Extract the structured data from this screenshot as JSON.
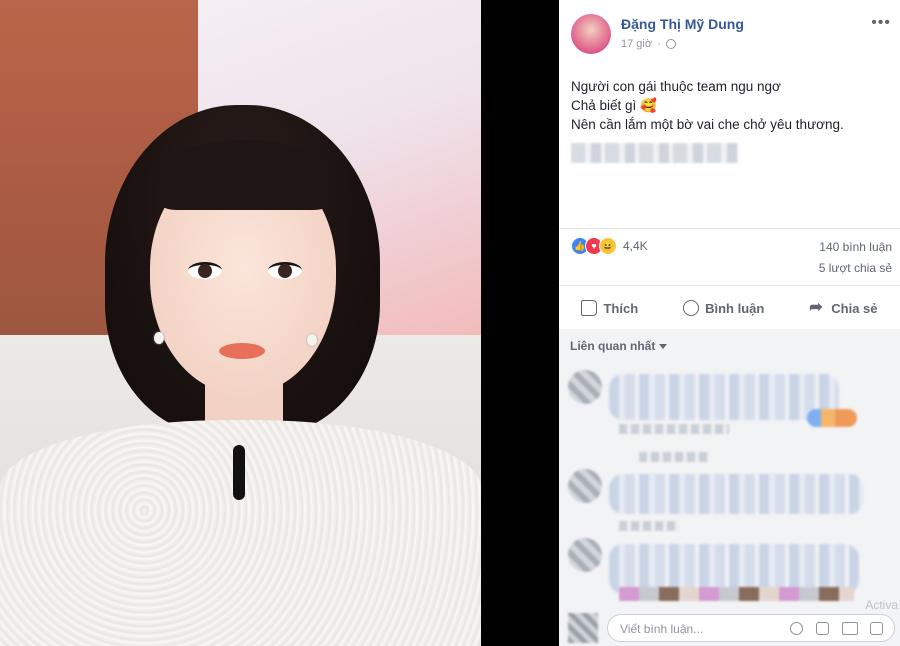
{
  "post": {
    "author": "Đặng Thị Mỹ Dung",
    "time": "17 giờ",
    "text_lines": [
      "Người con gái thuộc team ngu ngơ",
      "Chả biết gì 🥰",
      "Nên cần lắm một bờ vai che chở yêu thương."
    ],
    "reactions_count": "4,4K",
    "comments_count": "140 bình luận",
    "shares_count": "5 lượt chia sẻ"
  },
  "actions": {
    "like": "Thích",
    "comment": "Bình luận",
    "share": "Chia sẻ"
  },
  "comments": {
    "sort_label": "Liên quan nhất"
  },
  "composer": {
    "placeholder": "Viết bình luận..."
  },
  "watermark": "Activa",
  "icons": {
    "globe": "globe-icon",
    "more": "more-icon",
    "like": "thumb-icon",
    "comment": "comment-icon",
    "share": "share-icon",
    "emoji": "emoji-icon",
    "camera": "camera-icon",
    "gif": "gif-icon",
    "sticker": "sticker-icon"
  },
  "colors": {
    "link": "#365899",
    "secondary_text": "#606770",
    "like_blue": "#3b86f7",
    "love_red": "#f0384f",
    "haha_yellow": "#f7c43a"
  }
}
